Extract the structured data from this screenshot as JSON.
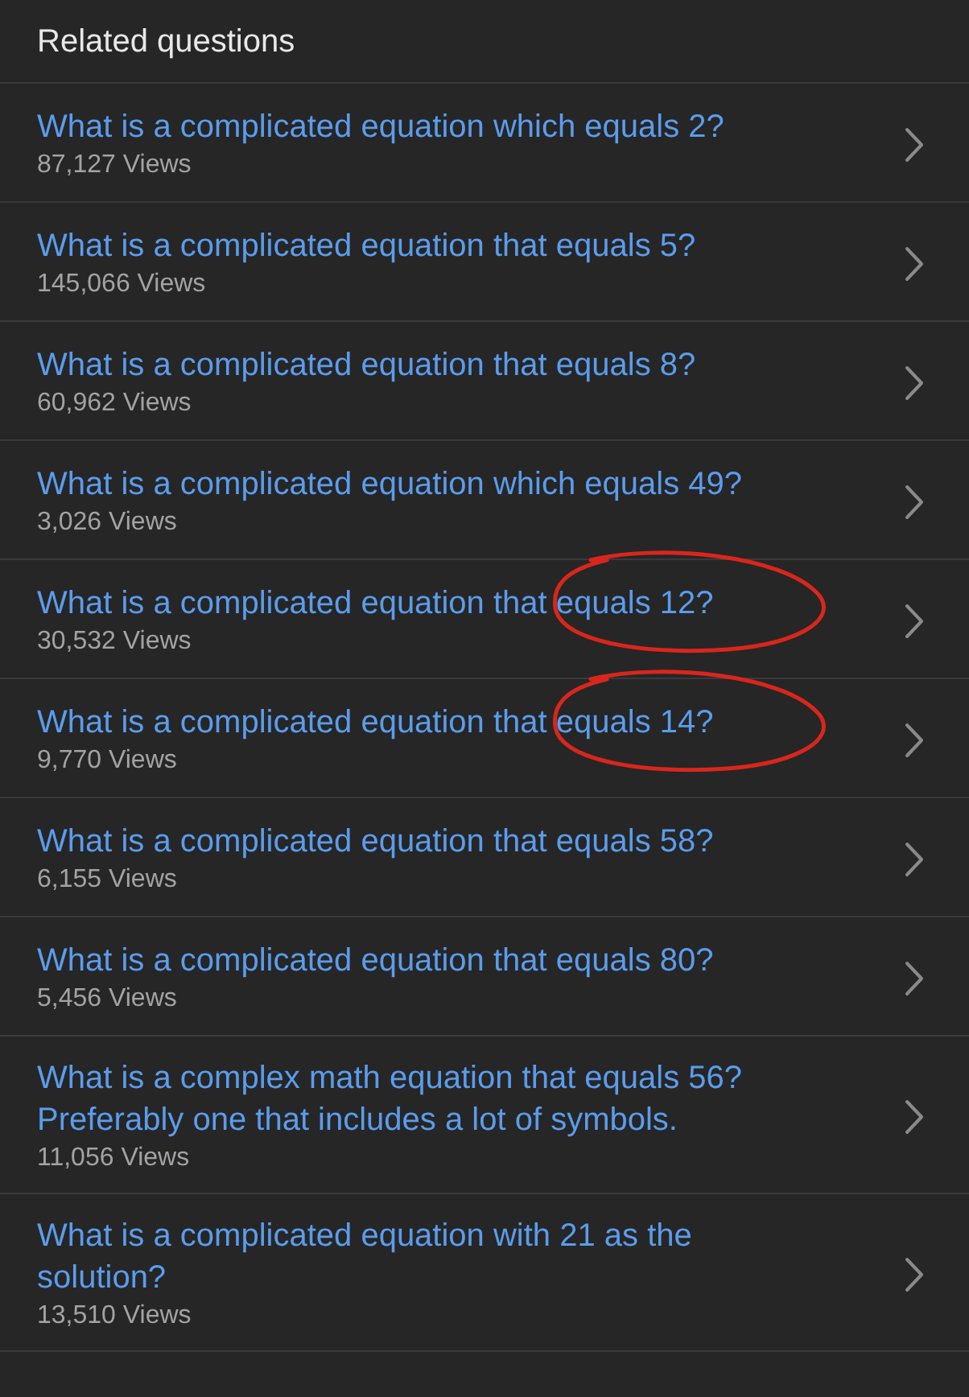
{
  "header": {
    "title": "Related questions"
  },
  "questions": [
    {
      "title": "What is a complicated equation which equals 2?",
      "views": "87,127 Views",
      "circled": false
    },
    {
      "title": "What is a complicated equation that equals 5?",
      "views": "145,066 Views",
      "circled": false
    },
    {
      "title": "What is a complicated equation that equals 8?",
      "views": "60,962 Views",
      "circled": false
    },
    {
      "title": "What is a complicated equation which equals 49?",
      "views": "3,026 Views",
      "circled": false
    },
    {
      "title": "What is a complicated equation that equals 12?",
      "views": "30,532 Views",
      "circled": true
    },
    {
      "title": "What is a complicated equation that equals 14?",
      "views": "9,770 Views",
      "circled": true
    },
    {
      "title": "What is a complicated equation that equals 58?",
      "views": "6,155 Views",
      "circled": false
    },
    {
      "title": "What is a complicated equation that equals 80?",
      "views": "5,456 Views",
      "circled": false
    },
    {
      "title": "What is a complex math equation that equals 56? Preferably one that includes a lot of symbols.",
      "views": "11,056 Views",
      "circled": false
    },
    {
      "title": "What is a complicated equation with 21 as the solution?",
      "views": "13,510 Views",
      "circled": false
    }
  ]
}
